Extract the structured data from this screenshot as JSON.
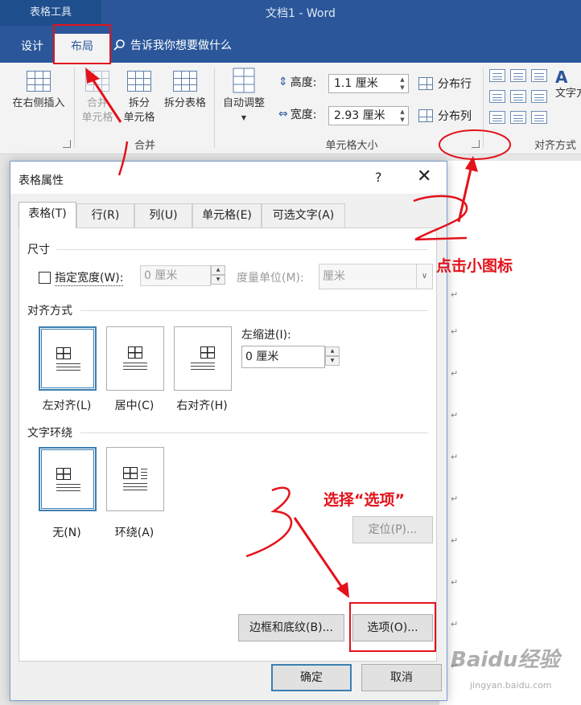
{
  "window": {
    "context_tab_group": "表格工具",
    "title": "文档1 - Word"
  },
  "ribbon_tabs": {
    "design": "设计",
    "layout": "布局",
    "tell_me": "告诉我你想要做什么"
  },
  "ribbon": {
    "insert_right": "在右侧插入",
    "merge_cells_1": "合并",
    "merge_cells_2": "单元格",
    "split_cells_1": "拆分",
    "split_cells_2": "单元格",
    "split_table": "拆分表格",
    "merge_group": "合并",
    "autofit": "自动调整",
    "height_label": "高度:",
    "height_value": "1.1 厘米",
    "width_label": "宽度:",
    "width_value": "2.93 厘米",
    "distribute_rows": "分布行",
    "distribute_cols": "分布列",
    "cell_size_group": "单元格大小",
    "text_direction": "文字方",
    "alignment_group": "对齐方式"
  },
  "dialog": {
    "title": "表格属性",
    "help": "?",
    "close": "✕",
    "tabs": [
      "表格(T)",
      "行(R)",
      "列(U)",
      "单元格(E)",
      "可选文字(A)"
    ],
    "size_section": "尺寸",
    "preferred_width_label": "指定宽度(W):",
    "preferred_width_value": "0 厘米",
    "measure_in_label": "度量单位(M):",
    "measure_in_value": "厘米",
    "alignment_section": "对齐方式",
    "align_left": "左对齐(L)",
    "align_center": "居中(C)",
    "align_right": "右对齐(H)",
    "indent_label": "左缩进(I):",
    "indent_value": "0 厘米",
    "wrap_section": "文字环绕",
    "wrap_none": "无(N)",
    "wrap_around": "环绕(A)",
    "positioning_button": "定位(P)...",
    "borders_button": "边框和底纹(B)...",
    "options_button": "选项(O)...",
    "ok_button": "确定",
    "cancel_button": "取消"
  },
  "annotations": {
    "click_icon": "点击小图标",
    "select_options": "选择“选项”",
    "step_2": "2",
    "step_3": "3"
  },
  "watermark": {
    "main": "Baidu经验",
    "sub": "jingyan.baidu.com"
  },
  "colors": {
    "title_blue": "#2b579a",
    "annotation_red": "#e3121b",
    "selected_blue": "#3c7fb1"
  }
}
